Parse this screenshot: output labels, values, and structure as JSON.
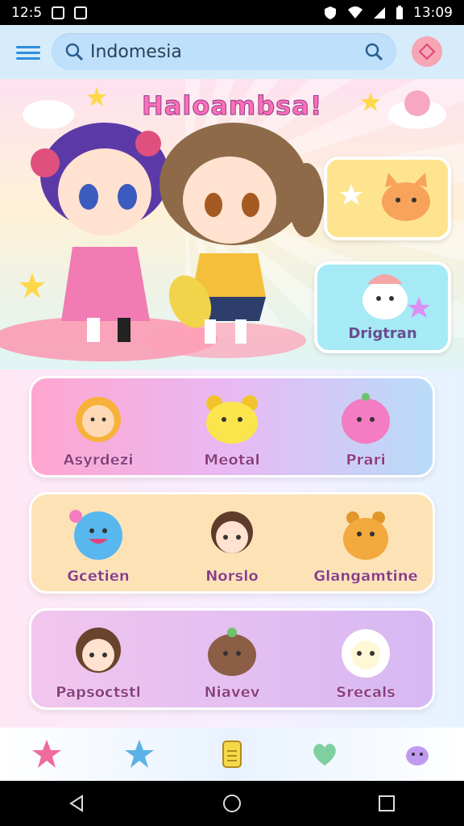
{
  "status": {
    "time": "12:5",
    "clock_right": "13:09"
  },
  "search": {
    "query": "Indomesia"
  },
  "hero": {
    "title": "Haloambsa!",
    "card_right_label": "Drigtran"
  },
  "grid": {
    "rows": [
      {
        "items": [
          {
            "label": "Asyrdezi"
          },
          {
            "label": "Meotal"
          },
          {
            "label": "Prari"
          }
        ]
      },
      {
        "items": [
          {
            "label": "Gcetien"
          },
          {
            "label": "Norslo"
          },
          {
            "label": "Glangamtine"
          }
        ]
      },
      {
        "items": [
          {
            "label": "Papsoctstl"
          },
          {
            "label": "Niavev"
          },
          {
            "label": "Srecals"
          }
        ]
      }
    ]
  },
  "colors": {
    "accent": "#2f8de0",
    "title_pink": "#ff6fb6",
    "label_purple": "#8a3c7f"
  }
}
